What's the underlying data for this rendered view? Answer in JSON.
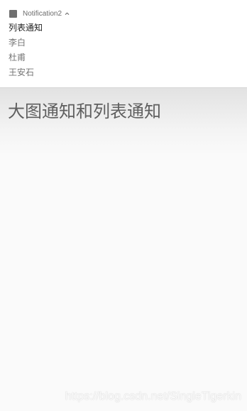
{
  "notification": {
    "app_icon": "app-square-icon",
    "app_name": "Notification2",
    "expand_icon": "chevron-up-icon",
    "title": "列表通知",
    "lines": [
      "李白",
      "杜甫",
      "王安石"
    ]
  },
  "app": {
    "title": "大图通知和列表通知"
  },
  "watermark": "https://blog.csdn.net/SingleTigerkin",
  "colors": {
    "app_icon": "#6f6f6f",
    "title_text": "#212121",
    "line_text": "#757575",
    "page_title": "#5f5f5f"
  }
}
